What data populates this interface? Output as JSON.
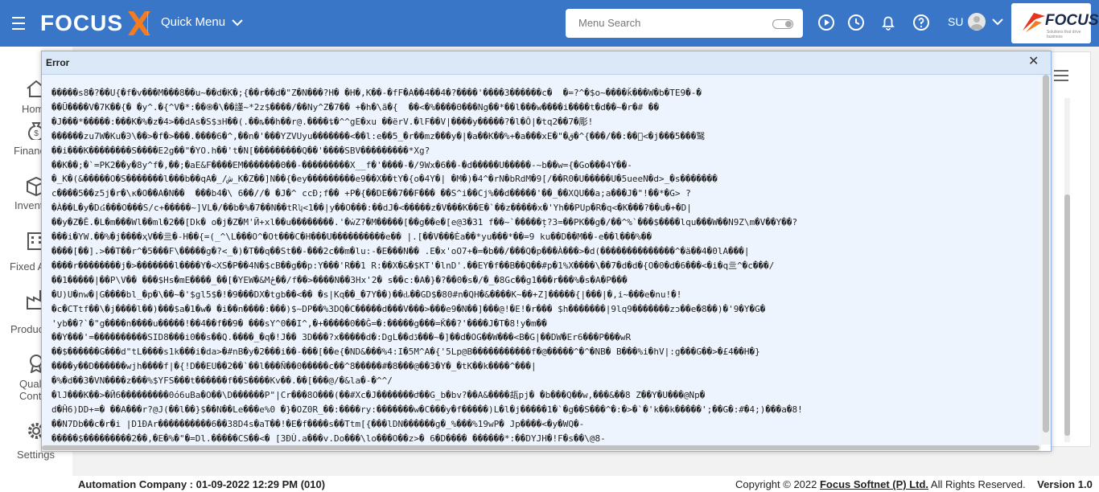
{
  "topbar": {
    "logo_text": "FOCUS",
    "quick_menu_label": "Quick Menu",
    "search_placeholder": "Menu Search",
    "user_initials": "SU",
    "brand_name": "FOCUS",
    "brand_tagline": "Solutions that drive business",
    "colors": {
      "bar": "#3a76c7",
      "logo_x": "#f47b20"
    }
  },
  "sidebar": {
    "items": [
      {
        "label": "Home",
        "icon": "home-icon"
      },
      {
        "label": "Financials",
        "icon": "money-bag-icon"
      },
      {
        "label": "Inventory",
        "icon": "inventory-icon"
      },
      {
        "label": "Fixed Assets",
        "icon": "building-icon"
      },
      {
        "label": "Production",
        "icon": "factory-icon"
      },
      {
        "label": "Quality Control",
        "icon": "quality-icon"
      },
      {
        "label": "Settings",
        "icon": "gear-icon"
      }
    ]
  },
  "dialog": {
    "title": "Error",
    "close_symbol": "✕",
    "lines": [
      "�����s8�?��U{�f�v���M���8��u~��d�K�;{��r��d�\"Z�N���?H� �H�,K��-�fF�A��4��4�?����'����3������c�  �=?^�$o~����ǩ���W�b�TE9�-�",
      "��Ũ����V�7K��{� �y^.�{^V�*:��֍�\\��謹~*2z$����/��Ny^Z�7�� +�h�\\ã�{  ��<�%����Θ���Ng��*��l���w����i����t�d��~�r�# ��",
      "�J���*�����:���K�%�z�4>��dAs�S$ɜH��(.��ȵ��h��r@.����ȶ�^^gE�xu ��ërV.�lF��V|����y�����?�l�Ô|�tq2��7�彫!",
      "������zu7W�Ku�Ͽ\\��>�f�>���.����6�^,��n�'���YZVUyu�������<��l:e��5_�r��mz���y�|�a��K��%+�a���xE�\"�ق�^{���/��:��ͥ<�j���5���鹥",
      "��i���K��������S����E2g��\"�YO.h��'t�N[���������Q��'����SBV���������*Xg?",
      "��K��;�`=PK2��y�8y^f�,��;�aE&F����EM�������Θ��-���������X__f�'����-�/9Wx�6��-�d�����U�����-~b��w={�Go���4Y��-",
      "�_K�(&�����O�S�������l���b��qA�_/ش_K�Z��]N��{�ey���������e9��X��tY�{o�4Y�| �M�)�4^�rN�bRdM�9[/��R0�U�����U�5ueeN�d>_�s�������",
      "c����5��z5j�r�\\κ�O��A�N��  ���b4�\\ 6��//� �J�^ ccĐ;f�� +P�{��DE��7��F��� ��S^i��Cj%��d�����'��_��XQU��a;a���J�\"!��*�G> ?",
      "�À��L�y�D៤���O���S/c+�����~]VL�/��b�%�7��N��tRʮ<1��|y��O���:��dJ�<�����z�V���K��E�`��z�����x�'Yh��PUp�R�q<�K���?��u�+�D|",
      "��y�Z�Ē.�L�m���Wl��ml�2��[Dk� o�j�Z�M'Й+xl��u��������.'�ẇZ?�M�����[��g��e�[e@3�31 f��~`�����ț?3=��PK��g�/��^%`���$����lqu���W��N9Z\\m�V��Y��?",
      "���i�YW.��%�j����ҳV��亖�-H��{=(_^\\L���O^�Ot���C�H���U����������e�� |.[��V���Èa��*yu���*��=9 ku��D��M��-e��l���%��",
      "����[��].>��T��r^�5���F\\�����g�?<_�)�T��q��St��-���2c��m�lu:-�E���N�� .E�x'oO7+�=�b��/���Q�p���À���>�d(��������������^�ä��4�0lA���|",
      "����r��������j�>�������l����Y�<XS�P��4N�$cB��g��p:Y���'R��1 R:��X�&�$KT'�lnD'.��EY�f��B��Q��#p�1%X����\\��7�d�d�{O�0�d�6���<�i�q亖^�c���/",
      "��1�����|��P\\V�� ���$Hs�mE����_��[�YEW�&Mځ��/f��>����N��3Hx'2� s��c:�A�}�?��0�s�/�_�8Gc��g1���r���%�s�A�P���",
      "�U)U�nw�|G����bl_�p�\\��~�'$gl5$�!�9���DX�tgb��<�� �s|Kq��_�7Y��)��ԃ��GD$�80#n�QH�&����K~��+Z]�����{|���|�,i~���e�nu!�!",
      "�c�CTtf��\\�j����l��)���$a�1�w� �i��n����:���)$~DP��%3DQ�C�����d���V���>���e9�N��]���@!�E!�r��� $h�������|9lq9�������zɔ��e�8��)�'9�Y�G�",
      "'yb��?`�\"g����n����u�����!��4��f��9� ���sY^0��I^,�+�����0��Ĝ=�:�����g���=Ǩ��?'����J�T�8!y�m��",
      "��Y���'=����������SID8���i0��s��Q.����_�q�!J�� 3D���?x�����d�:DgL��dڈ���~�]��d�OG��W���<B�G|��DW�Er6���P���wR",
      "��$������G���d\"tL����s1k���i�da>�#nB�y�2���i��-���[��e{�ND&���%4:I�5M^A�{'5Lp@B�����������f�@�����^�^�NB� B���%i�hV|:g���G��>�£4��H�}",
      "����y��D������wjh����f|�{!D��EU��2��`��l���Ñ��0�����c��^8�����#�8���@��3�Y�_�tK��k����^���|",
      "�%�d��3�VN����z���%$YFS���t������f��S����Kv��.��[���@/�&la�-�^^/",
      "�lJ���K��>�Й6���������0ó6uBa�O��\\D������P\"|Cr���8O���(��#Xc�J�������ժ��G_b�bv?��A&����瓳pj� �b���Q��w,���&��8 Z��Y�U���@Np�",
      "d�Ĥ6)DD+=� ��A���r?@J(��l��}$��N��Le���e%0 �}�OZ0R_��:����ry:�������w�C���y�f�����)L�l�j�����1�`�g��S���^�:�>�`�'k��k�����';��G�:#�4;)���a�8!",
      "��N7Db��c�r�i |D1ĐAr����������6��38D4s�aT��!�E�f����s��Ttm[{���lDN������g�_%���%19wP� Jp����<�y�WQ�-",
      "�����$���������2��,�E�%�\"�=Dl.�����CS��<� [3ĐÙ.a���v.Do���\\lo���O��z>� 6�D���� ������*:��DYJH�!F�s��\\@8-"
    ]
  },
  "footer": {
    "company_info": "Automation Company : 01-09-2022 12:29 PM (010)",
    "copyright_prefix": "Copyright © 2022",
    "copyright_company": "Focus Softnet (P) Ltd.",
    "copyright_suffix": " All Rights Reserved.",
    "version": "Version 1.0"
  }
}
